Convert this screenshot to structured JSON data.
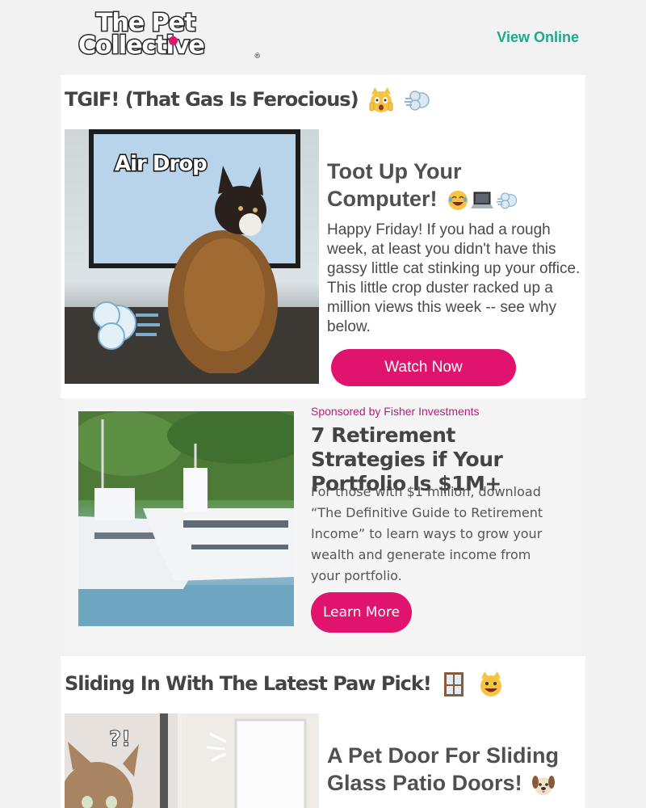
{
  "header": {
    "logo_line1": "The Pet",
    "logo_line2": "Collective",
    "logo_reg": "®",
    "view_online": "View Online"
  },
  "story1": {
    "section_title": "TGIF! (That Gas Is Ferocious)",
    "section_emojis": [
      "scared-cat-emoji",
      "dash-emoji"
    ],
    "image_caption": "Air Drop",
    "title": "Toot Up Your Computer!",
    "title_emojis": [
      "laughing-emoji",
      "laptop-emoji",
      "dash-emoji"
    ],
    "body": "Happy Friday! If you had a rough week, at least you didn't have this gassy little cat stinking up your office. This little crop duster racked up a million views this week -- see why below.",
    "button": "Watch Now"
  },
  "ad": {
    "sponsor": "Sponsored by Fisher Investments",
    "title": "7 Retirement Strategies if Your Portfolio Is $1M+",
    "body": "For those with $1 million, download “The Definitive Guide to Retirement Income” to learn ways to grow your wealth and generate income from your portfolio.",
    "button": "Learn More"
  },
  "story2": {
    "section_title": "Sliding In With The Latest Paw Pick!",
    "section_emojis": [
      "door-emoji",
      "smiling-cat-emoji"
    ],
    "title": "A Pet Door For Sliding Glass Patio Doors!",
    "title_emojis": [
      "dog-face-emoji"
    ]
  },
  "colors": {
    "accent": "#e0136f",
    "link": "#1bab86",
    "sponsor": "#c0187a",
    "text": "#4a4a4a",
    "page_bg": "#f2f2f2"
  }
}
